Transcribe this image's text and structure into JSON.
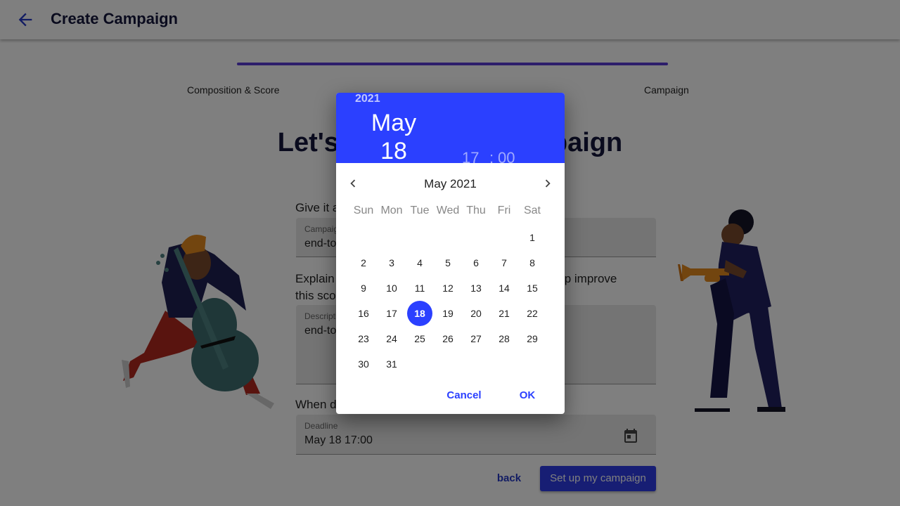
{
  "appbar": {
    "title": "Create Campaign",
    "back_icon": "arrow-left-icon"
  },
  "progress": {
    "fraction": 1.0,
    "steps": [
      "Composition & Score",
      "Campaign"
    ]
  },
  "heading": "Let's set up your campaign",
  "form": {
    "name_label": "Give it a name",
    "name_field_label": "Campaign name",
    "name_value": "end-to-end-test",
    "desc_label": "Explain what it is about and how musicians can help improve this score",
    "desc_field_label": "Description",
    "desc_value": "end-to-end-test",
    "deadline_question": "When does it end?",
    "deadline_field_label": "Deadline",
    "deadline_value": "May 18 17:00",
    "calendar_icon": "calendar-icon"
  },
  "actions": {
    "back_label": "back",
    "submit_label": "Set up my campaign"
  },
  "datepicker": {
    "year": "2021",
    "month": "May",
    "day": "18",
    "hour": "17",
    "colon": ":",
    "minute": "00",
    "month_year": "May 2021",
    "weekdays": [
      "Sun",
      "Mon",
      "Tue",
      "Wed",
      "Thu",
      "Fri",
      "Sat"
    ],
    "first_weekday_index": 6,
    "days_in_month": 31,
    "selected_day": 18,
    "prev_icon": "chevron-left-icon",
    "next_icon": "chevron-right-icon",
    "cancel_label": "Cancel",
    "ok_label": "OK",
    "accent_color": "#2b40ff"
  }
}
